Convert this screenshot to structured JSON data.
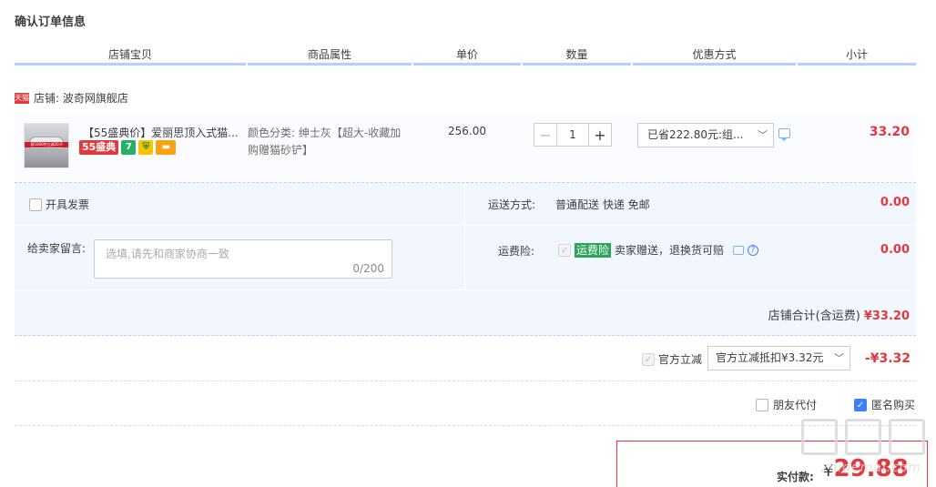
{
  "page_title": "确认订单信息",
  "columns": [
    "店铺宝贝",
    "商品属性",
    "单价",
    "数量",
    "优惠方式",
    "小计"
  ],
  "shop": {
    "badge": "天猫",
    "name": "店铺: 波奇网旗舰店"
  },
  "item": {
    "title": "【55盛典价】爱丽思顶入式猫...",
    "badge_55": "55盛典",
    "badge_7": "7",
    "attributes": "颜色分类: 绅士灰【超大-收藏加购赠猫砂铲】",
    "price": "256.00",
    "quantity": "1",
    "minus": "−",
    "plus": "+",
    "discount": "已省222.80元:组...",
    "subtotal": "33.20",
    "thumb_caption": "前1000件立减20.0"
  },
  "options": {
    "invoice_label": "开具发票",
    "memo_label": "给卖家留言:",
    "memo_placeholder": "选填,请先和商家协商一致",
    "memo_count": "0/200",
    "shipping_label": "运送方式:",
    "shipping_value": "普通配送 快递 免邮",
    "shipping_amount": "0.00",
    "insurance_label": "运费险:",
    "insurance_tag": "运费险",
    "insurance_text": "卖家赠送，退换货可赔",
    "insurance_amount": "0.00",
    "shop_total_label": "店铺合计(含运费)",
    "shop_total_amount": "¥33.20"
  },
  "official": {
    "label": "官方立减",
    "select": "官方立减抵扣¥3.32元",
    "amount": "-¥3.32"
  },
  "friend_pay": "朋友代付",
  "anonymous": "匿名购买",
  "payment": {
    "label": "实付款:",
    "currency": "¥",
    "amount": "29.88"
  },
  "watermark": "zhidemai.com",
  "icons": {
    "chevron": "chevron-down-icon",
    "chat": "chat-icon",
    "help": "help-icon",
    "check": "check-icon"
  },
  "colors": {
    "accent": "#e4393c",
    "blue_bar": "#b2d1ff",
    "panel": "#f2f7ff",
    "checkbox": "#3d7fff"
  }
}
